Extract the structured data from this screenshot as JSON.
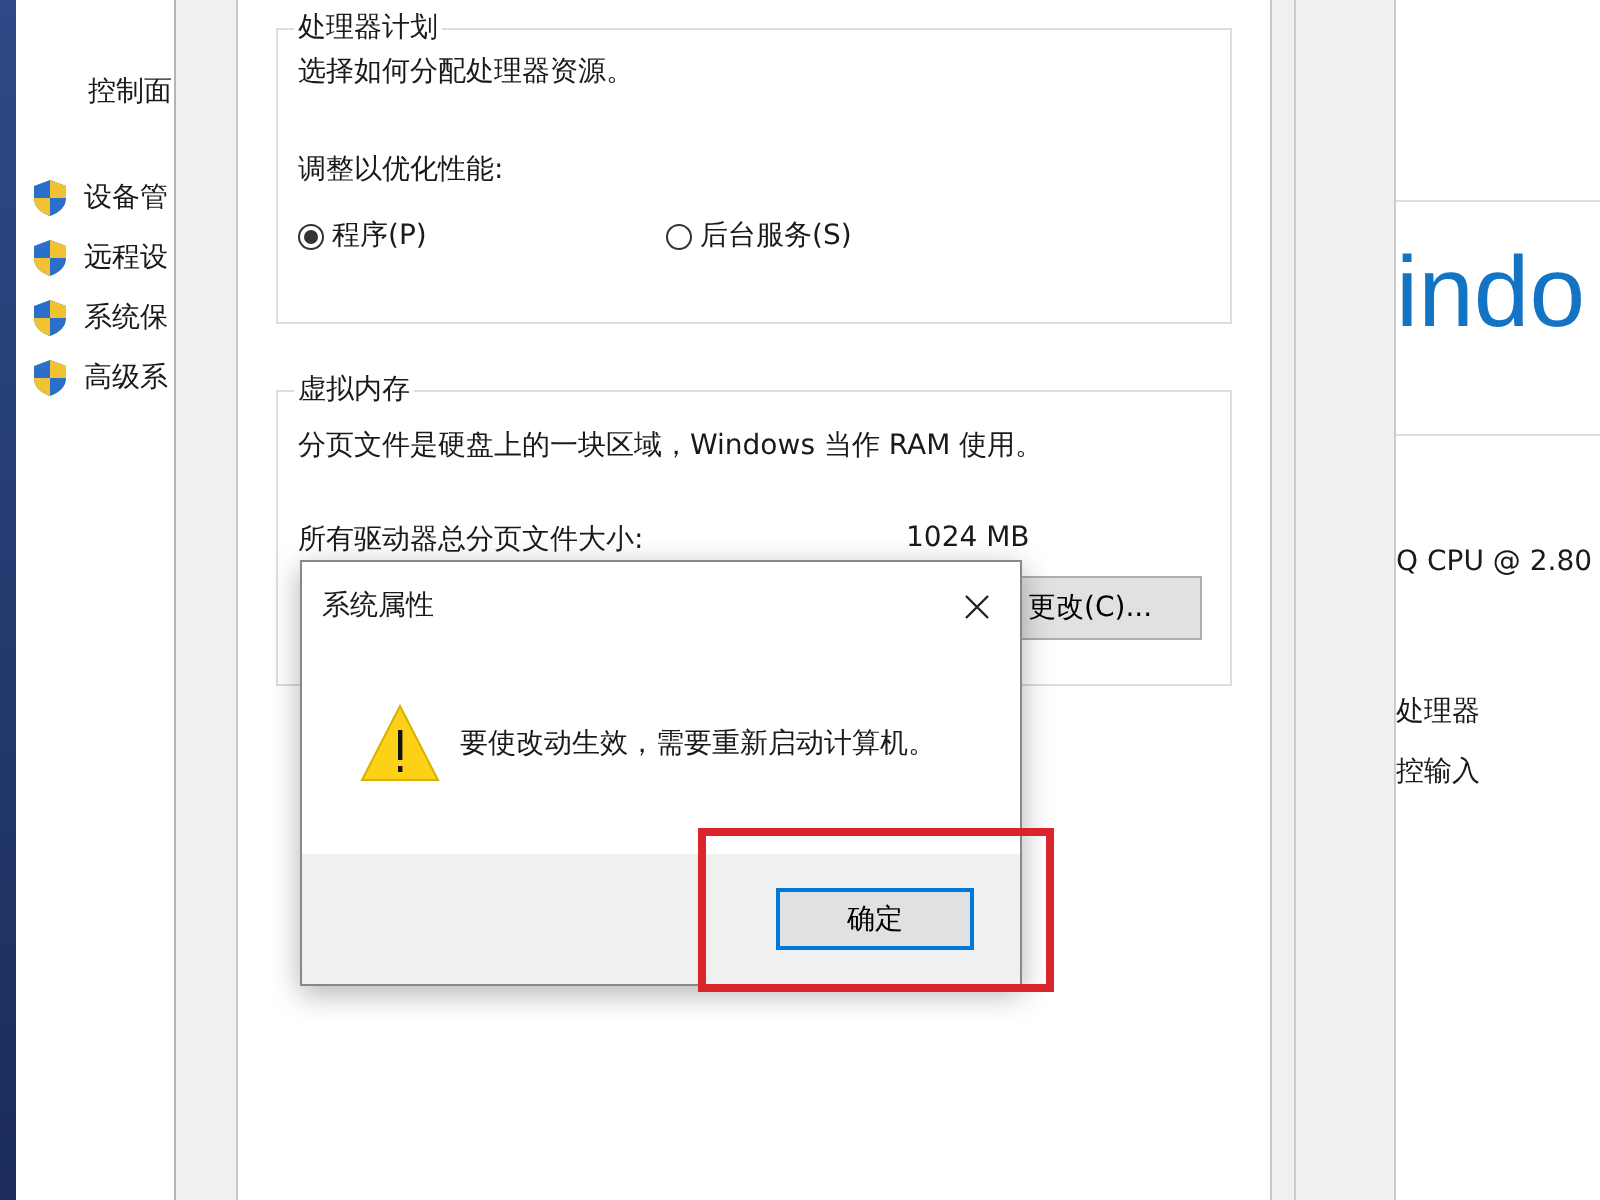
{
  "control_panel": {
    "nav_title": "控制面",
    "nav_items": [
      "设备管",
      "远程设",
      "系统保",
      "高级系"
    ],
    "logo_text": "indo",
    "details": [
      "Q CPU @ 2.80",
      "处理器",
      "控输入"
    ]
  },
  "performance_options": {
    "processor_group": {
      "title": "处理器计划",
      "description": "选择如何分配处理器资源。",
      "adjust_label": "调整以优化性能:",
      "options": [
        {
          "label": "程序(P)",
          "selected": true
        },
        {
          "label": "后台服务(S)",
          "selected": false
        }
      ]
    },
    "virtual_memory_group": {
      "title": "虚拟内存",
      "description": "分页文件是硬盘上的一块区域，Windows 当作 RAM 使用。",
      "total_label": "所有驱动器总分页文件大小:",
      "total_value": "1024 MB",
      "change_button": "更改(C)..."
    }
  },
  "dialog": {
    "title": "系统属性",
    "message": "要使改动生效，需要重新启动计算机。",
    "buttons": [
      "确定"
    ]
  }
}
